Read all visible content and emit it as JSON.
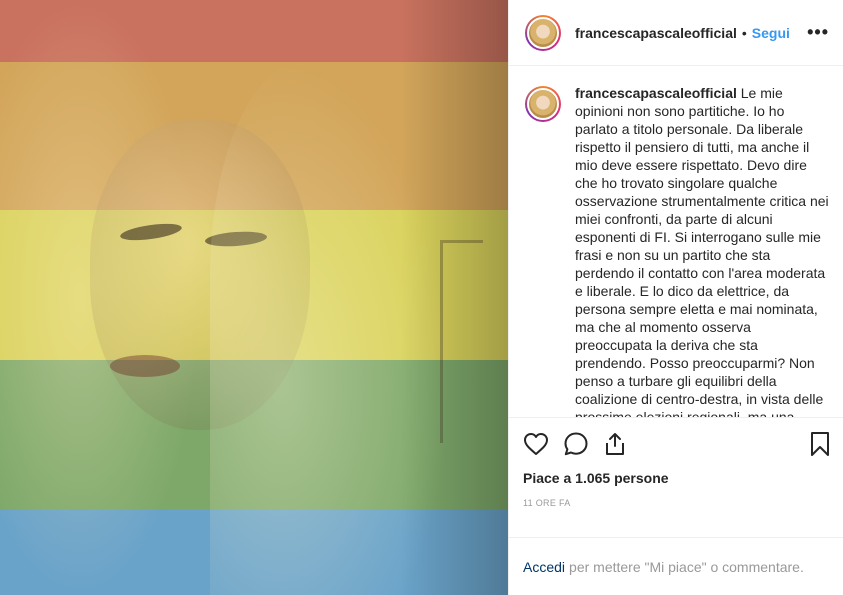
{
  "post": {
    "username": "francescapascaleofficial",
    "follow_label": "Segui",
    "separator": "•",
    "more_label": "•••",
    "caption": "Le mie opinioni non sono partitiche. Io ho parlato a titolo personale. Da liberale rispetto il pensiero di tutti, ma anche il mio deve essere rispettato. Devo dire che ho trovato singolare qualche osservazione strumentalmente critica nei miei confronti, da parte di alcuni esponenti di FI. Si interrogano sulle mie frasi e non su un partito che sta perdendo il contatto con l'area moderata e liberale. E lo dico da elettrice, da persona sempre eletta e mai nominata, ma che al momento osserva preoccupata la deriva che sta prendendo. Posso preoccuparmi? Non penso a turbare gli equilibri della coalizione di centro-destra, in vista delle prossime elezioni regionali, ma una riflessione sui contenuti è",
    "likes": "Piace a 1.065 persone",
    "time": "11 ORE FA"
  },
  "login": {
    "link": "Accedi",
    "text": "per mettere \"Mi piace\" o commentare."
  },
  "icons": [
    "heart-icon",
    "comment-icon",
    "share-icon",
    "bookmark-icon"
  ],
  "colors": {
    "accent": "#3897f0",
    "band_red": "#c9725f",
    "band_orange": "#d2a55a",
    "band_yellow": "#d9d25c",
    "band_green": "#7ea86a",
    "band_blue": "#6aa3c9"
  }
}
